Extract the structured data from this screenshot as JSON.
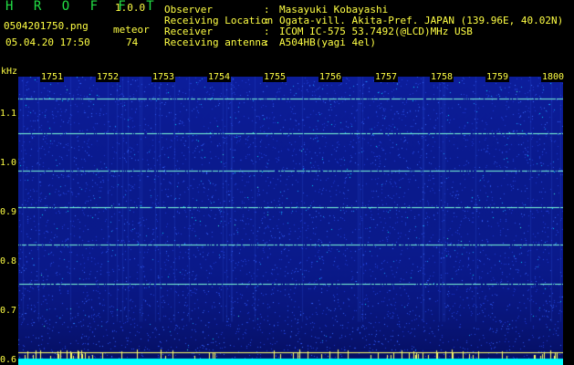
{
  "app": {
    "name": "H R O F F T",
    "version": "1.0.0"
  },
  "file": {
    "name": "0504201750.png",
    "datetime": "05.04.20 17:50"
  },
  "meteor": {
    "label": "meteor",
    "count": "74"
  },
  "info": [
    {
      "label": "Observer",
      "sep": ":",
      "value": "Masayuki Kobayashi"
    },
    {
      "label": "Receiving Location",
      "sep": ":",
      "value": "Ogata-vill. Akita-Pref. JAPAN (139.96E, 40.02N)"
    },
    {
      "label": "Receiver",
      "sep": ":",
      "value": "ICOM IC-575 53.7492(@LCD)MHz USB"
    },
    {
      "label": "Receiving antenna",
      "sep": ":",
      "value": "A504HB(yagi 4el)"
    }
  ],
  "yaxis": {
    "unit": "kHz",
    "ticks": [
      "1.1",
      "1.0",
      "0.9",
      "0.8",
      "0.7",
      "0.6"
    ],
    "min": 0.59,
    "max": 1.175
  },
  "xaxis": {
    "ticks": [
      "1751",
      "1752",
      "1753",
      "1754",
      "1755",
      "1756",
      "1757",
      "1758",
      "1759",
      "1800"
    ]
  },
  "spectrogram": {
    "bg": "#0a1a8c",
    "noise_colors": [
      "#1e3ad0",
      "#2a52e8",
      "#3a6cff",
      "#19a0ff",
      "#00e0ff",
      "#40ffe0"
    ],
    "lines_khz": [
      1.13,
      1.06,
      0.985,
      0.91,
      0.835,
      0.755
    ],
    "line_color": "#7cffd8",
    "bottom_lines_khz": [
      0.615,
      0.6
    ],
    "bottom_line_color": "#ffff66",
    "bottom_band_color": "#00ffff"
  }
}
